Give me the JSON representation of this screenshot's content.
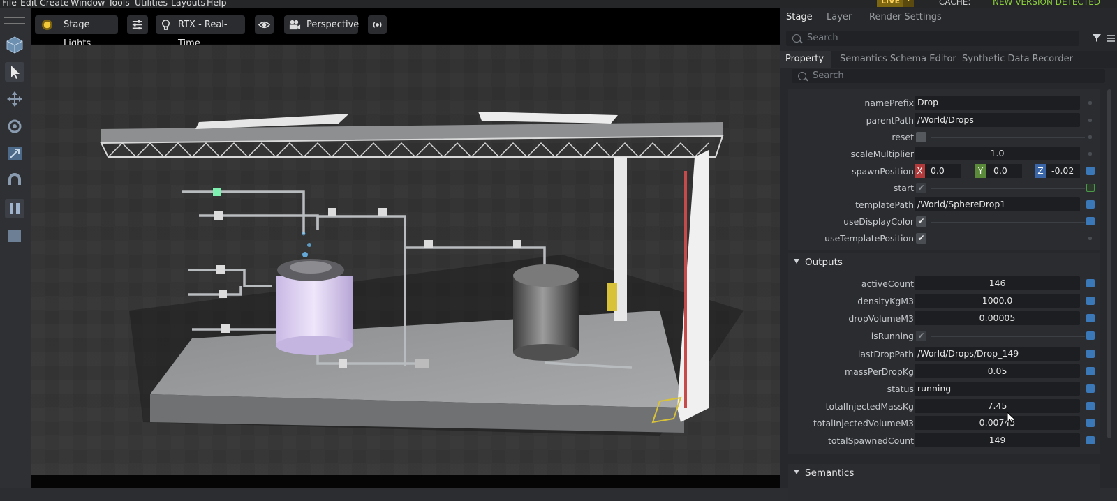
{
  "menu": [
    "File",
    "Edit",
    "Create",
    "Window",
    "Tools",
    "Utilities",
    "Layouts",
    "Help"
  ],
  "status": {
    "live": "LIVE",
    "cache": "CACHE:",
    "new_version": "NEW VERSION DETECTED"
  },
  "viewport": {
    "lights": "Stage Lights",
    "renderer": "RTX - Real-Time",
    "camera": "Perspective"
  },
  "panel": {
    "top_tabs": [
      "Stage",
      "Layer",
      "Render Settings"
    ],
    "top_search": "Search",
    "prop_tabs": [
      "Property",
      "Semantics Schema Editor",
      "Synthetic Data Recorder"
    ],
    "prop_search": "Search"
  },
  "props": {
    "namePrefix": {
      "label": "namePrefix",
      "value": "Drop"
    },
    "parentPath": {
      "label": "parentPath",
      "value": "/World/Drops"
    },
    "reset": {
      "label": "reset"
    },
    "scaleMultiplier": {
      "label": "scaleMultiplier",
      "value": "1.0"
    },
    "spawnPosition": {
      "label": "spawnPosition",
      "x": "0.0",
      "y": "0.0",
      "z": "-0.02",
      "xl": "X",
      "yl": "Y",
      "zl": "Z"
    },
    "start": {
      "label": "start"
    },
    "templatePath": {
      "label": "templatePath",
      "value": "/World/SphereDrop1"
    },
    "useDisplayColor": {
      "label": "useDisplayColor"
    },
    "useTemplatePosition": {
      "label": "useTemplatePosition"
    }
  },
  "outputs": {
    "title": "Outputs",
    "activeCount": {
      "label": "activeCount",
      "value": "146"
    },
    "densityKgM3": {
      "label": "densityKgM3",
      "value": "1000.0"
    },
    "dropVolumeM3": {
      "label": "dropVolumeM3",
      "value": "0.00005"
    },
    "isRunning": {
      "label": "isRunning"
    },
    "lastDropPath": {
      "label": "lastDropPath",
      "value": "/World/Drops/Drop_149"
    },
    "massPerDropKg": {
      "label": "massPerDropKg",
      "value": "0.05"
    },
    "status": {
      "label": "status",
      "value": "running"
    },
    "totalInjectedMassKg": {
      "label": "totalInjectedMassKg",
      "value": "7.45"
    },
    "totalInjectedVolumeM3": {
      "label": "totalInjectedVolumeM3",
      "value": "0.00745"
    },
    "totalSpawnedCount": {
      "label": "totalSpawnedCount",
      "value": "149"
    }
  },
  "semantics": {
    "title": "Semantics"
  },
  "checks": {
    "on": "✔"
  },
  "colors": {
    "accent": "#3a78b8",
    "live": "#7d6612",
    "new_version": "#8bd03a",
    "axis_x": "#b23a3a",
    "axis_y": "#5a8a3a",
    "axis_z": "#3a66a8"
  }
}
